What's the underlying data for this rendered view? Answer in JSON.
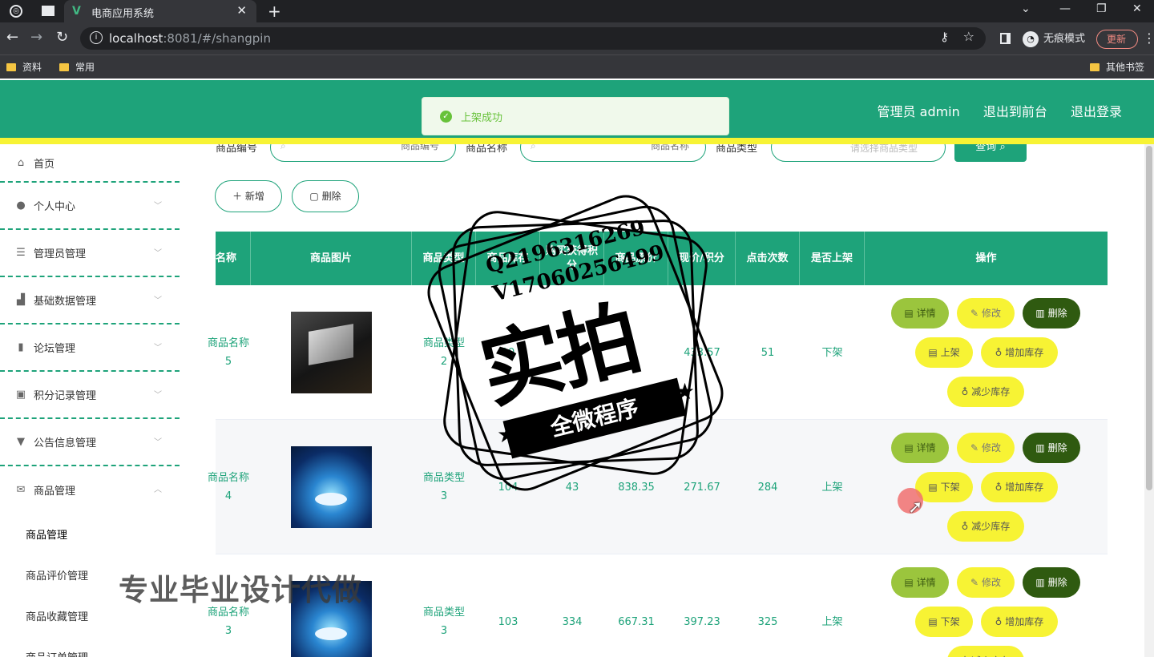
{
  "browser": {
    "tab_title": "电商应用系统",
    "tab_close": "✕",
    "new_tab": "+",
    "url_host": "localhost",
    "url_rest": ":8081/#/shangpin",
    "incognito_label": "无痕模式",
    "update_label": "更新",
    "bookmarks": [
      "资料",
      "常用"
    ],
    "other_bookmarks": "其他书签"
  },
  "header": {
    "admin_label": "管理员 admin",
    "to_front": "退出到前台",
    "logout": "退出登录"
  },
  "toast": {
    "text": "上架成功",
    "color": "#67c23a"
  },
  "sidebar": {
    "items": [
      {
        "label": "首页",
        "icon": "home-icon"
      },
      {
        "label": "个人中心",
        "icon": "user-icon"
      },
      {
        "label": "管理员管理",
        "icon": "sliders-icon"
      },
      {
        "label": "基础数据管理",
        "icon": "chart-line-icon"
      },
      {
        "label": "论坛管理",
        "icon": "bar-chart-icon"
      },
      {
        "label": "积分记录管理",
        "icon": "trash-icon"
      },
      {
        "label": "公告信息管理",
        "icon": "bell-icon"
      },
      {
        "label": "商品管理",
        "icon": "mail-icon"
      }
    ],
    "sub_items": [
      "商品管理",
      "商品评价管理",
      "商品收藏管理",
      "商品订单管理"
    ]
  },
  "search": {
    "label_code": "商品编号",
    "placeholder_code": "商品编号",
    "label_name": "商品名称",
    "placeholder_name": "商品名称",
    "label_type": "商品类型",
    "placeholder_type": "请选择商品类型",
    "query_label": "查询"
  },
  "toolbar": {
    "add_label": "新增",
    "delete_label": "删除"
  },
  "table": {
    "columns": [
      "名称",
      "商品图片",
      "商品类型",
      "商品库存",
      "购买获得积分",
      "商品原价",
      "现价/积分",
      "点击次数",
      "是否上架",
      "操作"
    ],
    "rows": [
      {
        "name": "商品名称5",
        "image": "laptop",
        "type": "商品类型2",
        "stock": "10",
        "points": "",
        "orig": "",
        "price": "433.57",
        "clicks": "51",
        "shelf": "下架",
        "shelf_action": "上架"
      },
      {
        "name": "商品名称4",
        "image": "blue",
        "type": "商品类型3",
        "stock": "104",
        "points": "43",
        "orig": "838.35",
        "price": "271.67",
        "clicks": "284",
        "shelf": "上架",
        "shelf_action": "下架"
      },
      {
        "name": "商品名称3",
        "image": "blue",
        "type": "商品类型3",
        "stock": "103",
        "points": "334",
        "orig": "667.31",
        "price": "397.23",
        "clicks": "325",
        "shelf": "上架",
        "shelf_action": "下架"
      }
    ],
    "ops": {
      "detail": "详情",
      "edit": "修改",
      "delete": "删除",
      "add_stock": "增加库存",
      "reduce_stock": "减少库存"
    }
  },
  "watermark": {
    "qq": "Q2196316269",
    "vx": "V17060256499",
    "big": "实拍",
    "band": "全微程序",
    "bottom": "专业毕业设计代做"
  },
  "colors": {
    "primary": "#1ea37a",
    "accent_yellow": "#f7f334",
    "detail_green": "#9bc53d",
    "delete_dark": "#2f5a10"
  }
}
